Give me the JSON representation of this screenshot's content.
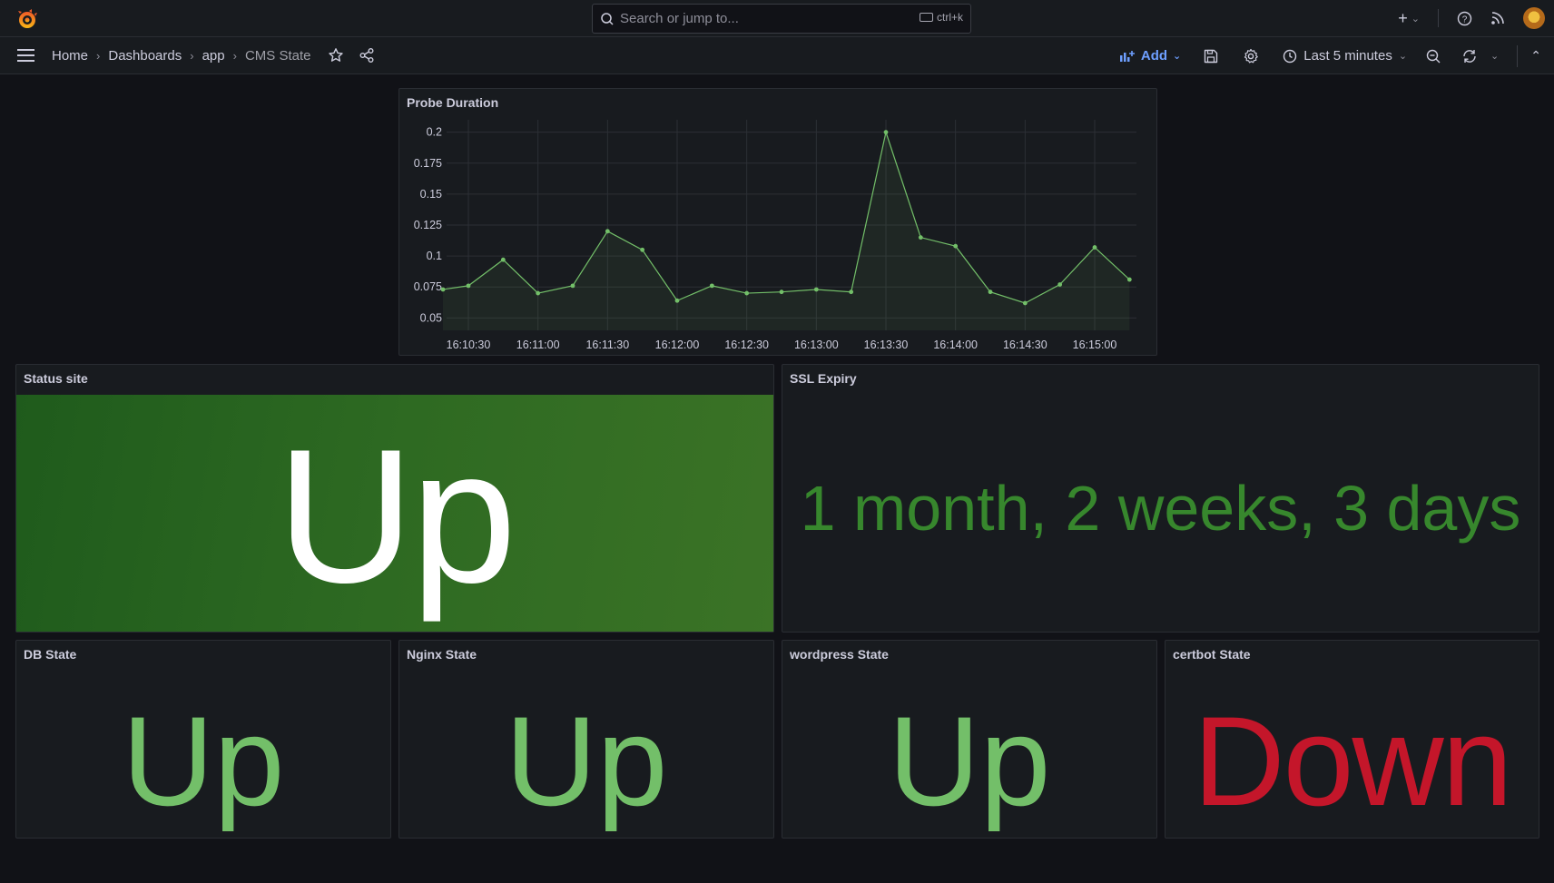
{
  "topbar": {
    "search_placeholder": "Search or jump to...",
    "shortcut": "ctrl+k",
    "new_icon": "plus-icon",
    "help_icon": "help-icon",
    "news_icon": "rss-icon"
  },
  "navbar": {
    "breadcrumbs": [
      "Home",
      "Dashboards",
      "app",
      "CMS State"
    ],
    "add_label": "Add",
    "time_range": "Last 5 minutes"
  },
  "colors": {
    "background": "#111217",
    "panel": "#181b1f",
    "green_text": "#73bf69",
    "dark_green_text": "#37872d",
    "red_text": "#c4162a",
    "up_bg_start": "#1f5b1c",
    "up_bg_end": "#3b7326",
    "accent_blue": "#6e9fff"
  },
  "panels": {
    "probe": {
      "title": "Probe Duration"
    },
    "status_site": {
      "title": "Status site",
      "value": "Up"
    },
    "ssl": {
      "title": "SSL Expiry",
      "value": "1 month, 2 weeks, 3 days"
    },
    "db": {
      "title": "DB State",
      "value": "Up"
    },
    "nginx": {
      "title": "Nginx State",
      "value": "Up"
    },
    "wordpress": {
      "title": "wordpress State",
      "value": "Up"
    },
    "certbot": {
      "title": "certbot State",
      "value": "Down"
    }
  },
  "chart_data": {
    "type": "line",
    "title": "Probe Duration",
    "xlabel": "",
    "ylabel": "",
    "x_ticks": [
      "16:10:30",
      "16:11:00",
      "16:11:30",
      "16:12:00",
      "16:12:30",
      "16:13:00",
      "16:13:30",
      "16:14:00",
      "16:14:30",
      "16:15:00"
    ],
    "y_ticks": [
      "0.05",
      "0.075",
      "0.1",
      "0.125",
      "0.15",
      "0.175",
      "0.2"
    ],
    "ylim": [
      0.04,
      0.21
    ],
    "grid": true,
    "series": [
      {
        "x": [
          "16:10:15",
          "16:10:30",
          "16:10:45",
          "16:11:00",
          "16:11:15",
          "16:11:30",
          "16:11:45",
          "16:12:00",
          "16:12:15",
          "16:12:30",
          "16:12:45",
          "16:13:00",
          "16:13:15",
          "16:13:30",
          "16:13:45",
          "16:14:00",
          "16:14:15",
          "16:14:30",
          "16:14:45",
          "16:15:00",
          "16:15:15"
        ],
        "values": [
          0.073,
          0.076,
          0.097,
          0.07,
          0.076,
          0.12,
          0.105,
          0.064,
          0.076,
          0.07,
          0.071,
          0.073,
          0.071,
          0.2,
          0.115,
          0.108,
          0.071,
          0.062,
          0.077,
          0.107,
          0.081
        ]
      }
    ]
  }
}
